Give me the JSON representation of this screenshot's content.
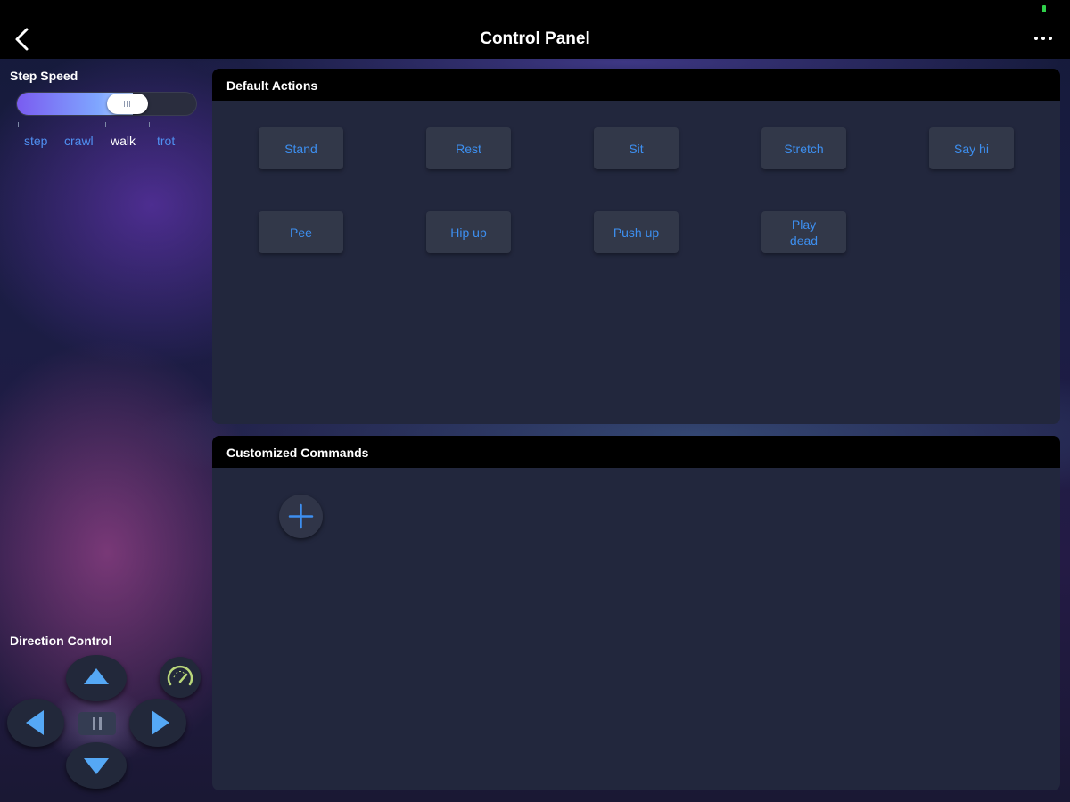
{
  "header": {
    "title": "Control Panel",
    "back_icon": "chevron-left-icon",
    "more_icon": "more-horizontal-icon"
  },
  "step_speed": {
    "label": "Step Speed",
    "options": [
      "step",
      "crawl",
      "walk",
      "trot"
    ],
    "selected": "walk",
    "level": 0.6
  },
  "default_actions": {
    "title": "Default Actions",
    "buttons": [
      "Stand",
      "Rest",
      "Sit",
      "Stretch",
      "Say hi",
      "Pee",
      "Hip up",
      "Push up",
      "Play\ndead"
    ]
  },
  "custom_commands": {
    "title": "Customized Commands",
    "add_icon": "plus-icon"
  },
  "direction_control": {
    "label": "Direction Control",
    "icons": [
      "arrow-up-icon",
      "arrow-left-icon",
      "pause-icon",
      "arrow-right-icon",
      "arrow-down-icon",
      "speedometer-icon"
    ]
  },
  "colors": {
    "accent": "#3d8ff0",
    "panel": "#22273d",
    "header": "#000000",
    "active_label": "#ffffff"
  }
}
